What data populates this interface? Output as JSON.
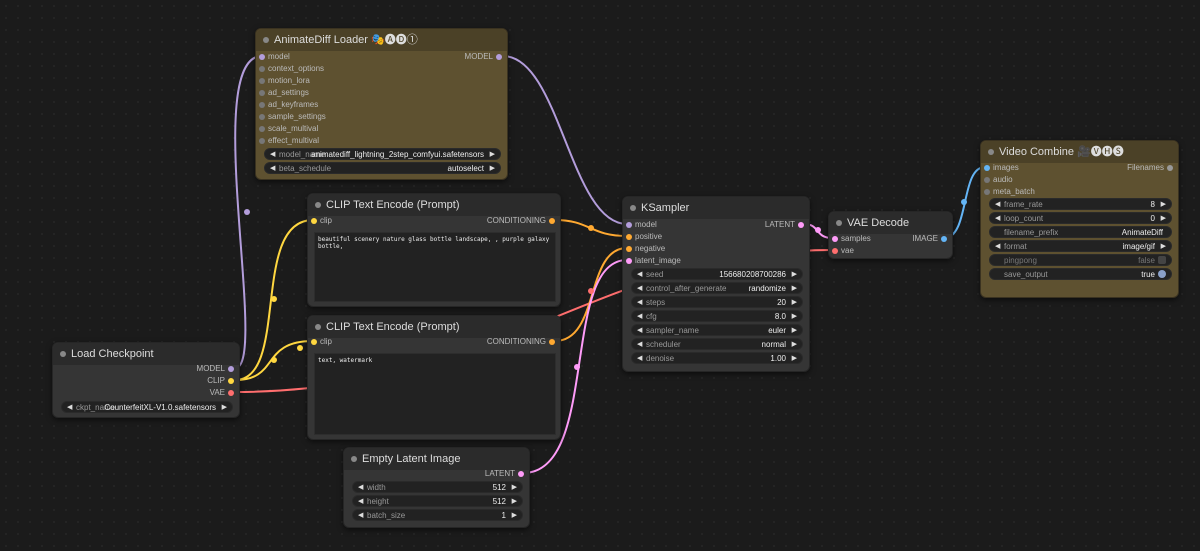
{
  "colors": {
    "model": "#b39ddb",
    "clip": "#ffd740",
    "vae": "#ff6e6e",
    "conditioning": "#ffa931",
    "latent": "#ff9cf9",
    "image": "#64b5f6"
  },
  "animatediff": {
    "title": "AnimateDiff Loader 🎭🅐🅓①",
    "inputs": [
      "model",
      "context_options",
      "motion_lora",
      "ad_settings",
      "ad_keyframes",
      "sample_settings",
      "scale_multival",
      "effect_multival"
    ],
    "output": "MODEL",
    "model_name_label": "model_name",
    "model_name_value": "animatediff_lightning_2step_comfyui.safetensors",
    "beta_schedule_label": "beta_schedule",
    "beta_schedule_value": "autoselect"
  },
  "clip_pos": {
    "title": "CLIP Text Encode (Prompt)",
    "input": "clip",
    "output": "CONDITIONING",
    "text": "beautiful scenery nature glass bottle landscape, , purple galaxy bottle,"
  },
  "clip_neg": {
    "title": "CLIP Text Encode (Prompt)",
    "input": "clip",
    "output": "CONDITIONING",
    "text": "text, watermark"
  },
  "checkpoint": {
    "title": "Load Checkpoint",
    "outputs": [
      "MODEL",
      "CLIP",
      "VAE"
    ],
    "ckpt_label": "ckpt_name",
    "ckpt_value": "CounterfeitXL-V1.0.safetensors"
  },
  "latent": {
    "title": "Empty Latent Image",
    "output": "LATENT",
    "widgets": [
      {
        "label": "width",
        "value": "512"
      },
      {
        "label": "height",
        "value": "512"
      },
      {
        "label": "batch_size",
        "value": "1"
      }
    ]
  },
  "ksampler": {
    "title": "KSampler",
    "inputs": [
      "model",
      "positive",
      "negative",
      "latent_image"
    ],
    "output": "LATENT",
    "widgets": [
      {
        "label": "seed",
        "value": "156680208700286"
      },
      {
        "label": "control_after_generate",
        "value": "randomize"
      },
      {
        "label": "steps",
        "value": "20"
      },
      {
        "label": "cfg",
        "value": "8.0"
      },
      {
        "label": "sampler_name",
        "value": "euler"
      },
      {
        "label": "scheduler",
        "value": "normal"
      },
      {
        "label": "denoise",
        "value": "1.00"
      }
    ]
  },
  "vaedecode": {
    "title": "VAE Decode",
    "inputs": [
      "samples",
      "vae"
    ],
    "output": "IMAGE"
  },
  "videocombine": {
    "title": "Video Combine 🎥🅥🅗🅢",
    "inputs": [
      "images",
      "audio",
      "meta_batch"
    ],
    "output": "Filenames",
    "frame_rate_label": "frame_rate",
    "frame_rate_value": "8",
    "loop_count_label": "loop_count",
    "loop_count_value": "0",
    "filename_prefix_label": "filename_prefix",
    "filename_prefix_value": "AnimateDiff",
    "format_label": "format",
    "format_value": "image/gif",
    "pingpong_label": "pingpong",
    "pingpong_value": "false",
    "save_output_label": "save_output",
    "save_output_value": "true"
  }
}
